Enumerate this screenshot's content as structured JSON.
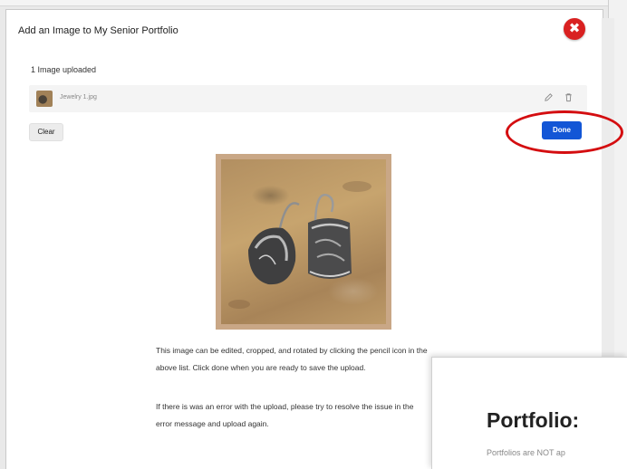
{
  "modal": {
    "title": "Add an Image to My Senior Portfolio",
    "close_symbol": "✖"
  },
  "upload": {
    "count_text": "1 Image uploaded",
    "file": {
      "name": "Jewelry 1.jpg",
      "edit_icon": "pencil-icon",
      "delete_icon": "trash-icon"
    }
  },
  "actions": {
    "clear_label": "Clear",
    "done_label": "Done"
  },
  "description": {
    "paragraph1": "This image can be edited, cropped, and rotated by clicking the pencil icon in the above list. Click done when you are ready to save the upload.",
    "paragraph2": "If there is was an error with the upload, please try to resolve the issue in the error message and upload again."
  },
  "overlay": {
    "title": "Portfolio:",
    "text": "Portfolios are NOT ap"
  },
  "colors": {
    "close_red": "#d92121",
    "done_blue": "#1356d6",
    "annotation_circle": "#d40d10"
  }
}
